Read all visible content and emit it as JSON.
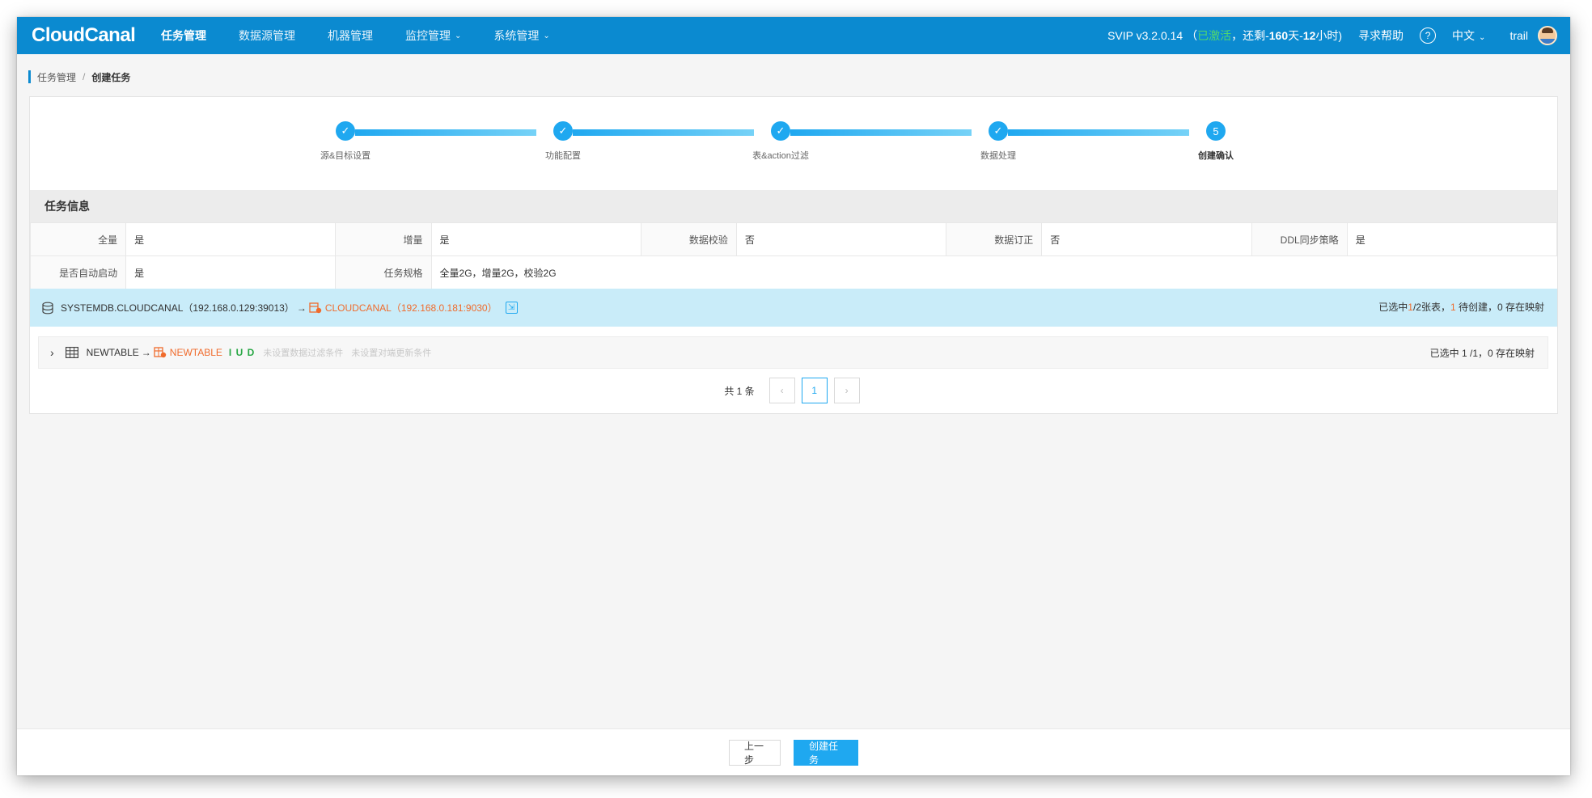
{
  "app": {
    "logo": "CloudCanal"
  },
  "nav": {
    "items": [
      {
        "label": "任务管理",
        "active": true
      },
      {
        "label": "数据源管理"
      },
      {
        "label": "机器管理"
      },
      {
        "label": "监控管理",
        "dropdown": true
      },
      {
        "label": "系统管理",
        "dropdown": true
      }
    ]
  },
  "topbar": {
    "version": "SVIP v3.2.0.14",
    "open_paren": "（",
    "activated": "已激活",
    "remaining_prefix": "，还剩-",
    "days": "160",
    "days_unit": "天-",
    "hours": "12",
    "hours_unit": "小时)",
    "help": "寻求帮助",
    "help_icon": "?",
    "language": "中文",
    "user": "trail"
  },
  "breadcrumb": {
    "parent": "任务管理",
    "separator": "/",
    "current": "创建任务"
  },
  "steps": [
    {
      "label": "源&目标设置",
      "status": "done",
      "mark": "✓"
    },
    {
      "label": "功能配置",
      "status": "done",
      "mark": "✓"
    },
    {
      "label": "表&action过滤",
      "status": "done",
      "mark": "✓"
    },
    {
      "label": "数据处理",
      "status": "done",
      "mark": "✓"
    },
    {
      "label": "创建确认",
      "status": "current",
      "mark": "5"
    }
  ],
  "task_info": {
    "title": "任务信息",
    "row1": [
      {
        "key": "全量",
        "value": "是"
      },
      {
        "key": "增量",
        "value": "是"
      },
      {
        "key": "数据校验",
        "value": "否"
      },
      {
        "key": "数据订正",
        "value": "否"
      },
      {
        "key": "DDL同步策略",
        "value": "是"
      }
    ],
    "row2": [
      {
        "key": "是否自动启动",
        "value": "是"
      },
      {
        "key": "任务规格",
        "value": "全量2G，增量2G，校验2G"
      }
    ]
  },
  "datasource": {
    "source": "SYSTEMDB.CLOUDCANAL（192.168.0.129:39013）",
    "arrow": "→",
    "target": "CLOUDCANAL（192.168.0.181:9030）",
    "summary_prefix": "已选中",
    "summary_selected": "1",
    "summary_mid": "/2张表，",
    "summary_pending": "1",
    "summary_suffix": " 待创建，0 存在映射"
  },
  "table_mapping": {
    "expand": "›",
    "source": "NEWTABLE",
    "arrow": "→",
    "target": "NEWTABLE",
    "actions": "I U D",
    "filter_hint": "未设置数据过滤条件",
    "update_hint": "未设置对端更新条件",
    "summary": "已选中 1 /1，0 存在映射"
  },
  "pagination": {
    "total": "共 1 条",
    "prev": "‹",
    "page": "1",
    "next": "›"
  },
  "footer": {
    "prev_label": "上一步",
    "create_label": "创建任务"
  },
  "colors": {
    "primary": "#0b8ad0",
    "accent": "#1fa8f0",
    "orange": "#f06b2c",
    "green": "#28a745"
  }
}
